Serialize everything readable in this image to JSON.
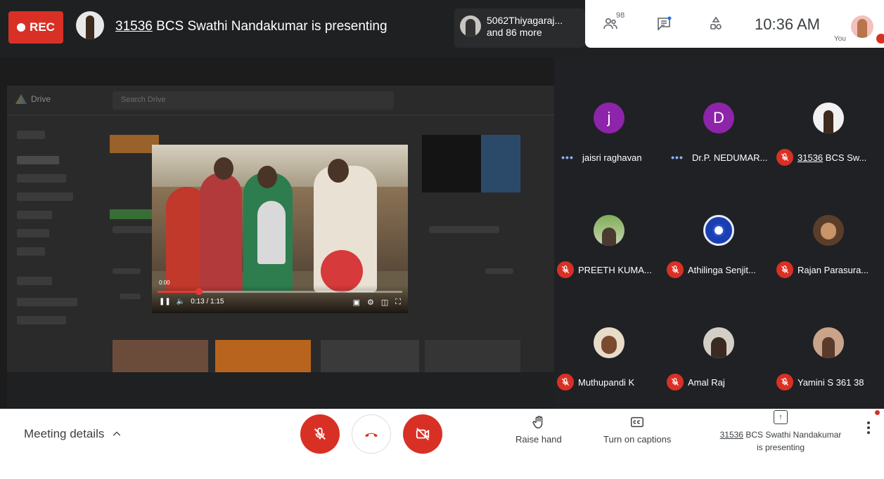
{
  "top": {
    "rec_label": "REC",
    "presenter_id": "31536",
    "presenter_rest": " BCS Swathi Nandakumar is presenting",
    "others_line1": "5062Thiyagaraj...",
    "others_line2": "and 86 more",
    "participant_count": "98",
    "time": "10:36 AM",
    "you_label": "You"
  },
  "video": {
    "time_small": "0:00",
    "timecode": "0:13 / 1:15",
    "progress": 0.17
  },
  "participants": [
    {
      "name": "jaisri raghavan",
      "initial": "j",
      "color": "#8e24aa",
      "status": "speaking"
    },
    {
      "name": "Dr.P. NEDUMAR...",
      "initial": "D",
      "color": "#8e24aa",
      "status": "speaking"
    },
    {
      "name_id": "31536",
      "name": " BCS Sw...",
      "status": "muted",
      "photo": "presenter"
    },
    {
      "name": "PREETH KUMA...",
      "status": "muted",
      "photo": "outdoor"
    },
    {
      "name": "Athilinga Senjit...",
      "status": "muted",
      "photo": "logo"
    },
    {
      "name": "Rajan Parasura...",
      "status": "muted",
      "photo": "man"
    },
    {
      "name": "Muthupandi K",
      "status": "muted",
      "photo": "woman"
    },
    {
      "name": "Amal Raj",
      "status": "muted",
      "photo": "man2"
    },
    {
      "name": "Yamini S 361 38",
      "status": "muted",
      "photo": "woman2"
    }
  ],
  "bottom": {
    "meeting_details": "Meeting details",
    "raise_hand": "Raise hand",
    "captions": "Turn on captions",
    "pres_id": "31536",
    "pres_line1": " BCS Swathi Nandakumar",
    "pres_line2": "is presenting"
  },
  "colors": {
    "red": "#d93025",
    "dark": "#202124",
    "accent_blue": "#8ab4f8"
  }
}
